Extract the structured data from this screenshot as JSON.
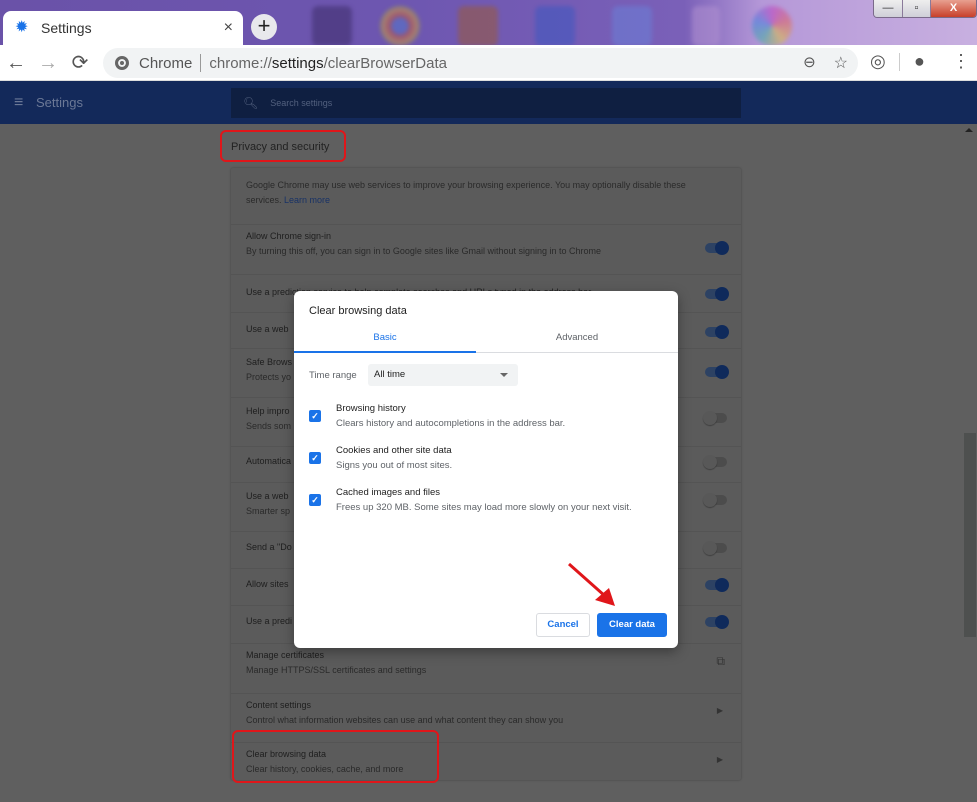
{
  "browser": {
    "tab_title": "Settings",
    "tab_close": "×",
    "new_tab": "+",
    "window_controls": {
      "minimize": "—",
      "maximize": "▫",
      "close": "X"
    },
    "nav": {
      "back": "←",
      "forward": "→",
      "reload": "⟳"
    },
    "omnibox": {
      "chip": "Chrome",
      "url_scheme": "chrome://",
      "url_host": "settings",
      "url_path": "/clearBrowserData"
    },
    "omni_icons": {
      "zoom": "🔍",
      "bookmark": "☆"
    },
    "toolbar_icons": {
      "extension": "◎",
      "profile": "●",
      "menu": "⋮"
    }
  },
  "settings_header": {
    "menu_icon": "≡",
    "title": "Settings",
    "search_icon": "⚲",
    "search_placeholder": "Search settings"
  },
  "section": {
    "title": "Privacy and security",
    "intro": "Google Chrome may use web services to improve your browsing experience. You may optionally disable these",
    "intro2": "services.",
    "learn_more": "Learn more",
    "rows": [
      {
        "title": "Allow Chrome sign-in",
        "desc": "By turning this off, you can sign in to Google sites like Gmail without signing in to Chrome",
        "control": "toggle",
        "on": true
      },
      {
        "title": "Use a prediction service to help complete searches and URLs typed in the address bar",
        "desc": "",
        "control": "toggle",
        "on": true
      },
      {
        "title": "Use a web",
        "desc": "",
        "control": "toggle",
        "on": true
      },
      {
        "title": "Safe Brows",
        "desc": "Protects yo",
        "control": "toggle",
        "on": true
      },
      {
        "title": "Help impro",
        "desc": "Sends som",
        "control": "toggle",
        "on": false
      },
      {
        "title": "Automatica",
        "desc": "",
        "control": "toggle",
        "on": false
      },
      {
        "title": "Use a web",
        "desc": "Smarter sp",
        "control": "toggle",
        "on": false
      },
      {
        "title": "Send a \"Do",
        "desc": "",
        "control": "toggle",
        "on": false
      },
      {
        "title": "Allow sites",
        "desc": "",
        "control": "toggle",
        "on": true
      },
      {
        "title": "Use a predi",
        "desc": "",
        "control": "toggle",
        "on": true
      },
      {
        "title": "Manage certificates",
        "desc": "Manage HTTPS/SSL certificates and settings",
        "control": "external"
      },
      {
        "title": "Content settings",
        "desc": "Control what information websites can use and what content they can show you",
        "control": "arrow"
      },
      {
        "title": "Clear browsing data",
        "desc": "Clear history, cookies, cache, and more",
        "control": "arrow"
      }
    ]
  },
  "dialog": {
    "title": "Clear browsing data",
    "tabs": [
      {
        "label": "Basic",
        "active": true
      },
      {
        "label": "Advanced",
        "active": false
      }
    ],
    "time_range_label": "Time range",
    "time_range_value": "All time",
    "options": [
      {
        "title": "Browsing history",
        "desc": "Clears history and autocompletions in the address bar.",
        "checked": true
      },
      {
        "title": "Cookies and other site data",
        "desc": "Signs you out of most sites.",
        "checked": true
      },
      {
        "title": "Cached images and files",
        "desc": "Frees up 320 MB. Some sites may load more slowly on your next visit.",
        "checked": true
      }
    ],
    "checkmark": "✓",
    "cancel_label": "Cancel",
    "clear_label": "Clear data"
  },
  "colors": {
    "accent": "#1a73e8",
    "annotation": "#e0161a",
    "header_bg": "#13295a"
  }
}
